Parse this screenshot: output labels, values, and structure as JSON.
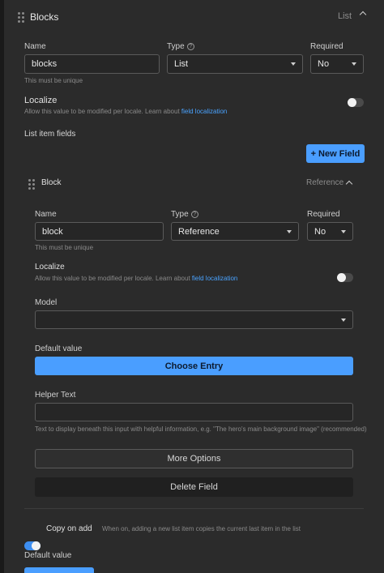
{
  "field": {
    "title": "Blocks",
    "type_badge": "List",
    "name_label": "Name",
    "name_value": "blocks",
    "name_hint": "This must be unique",
    "type_label": "Type",
    "type_value": "List",
    "required_label": "Required",
    "required_value": "No",
    "localize_label": "Localize",
    "localize_hint": "Allow this value to be modified per locale. Learn about",
    "localize_link": "field localization",
    "list_item_fields_label": "List item fields",
    "new_field_button": "+ New Field",
    "copy_on_add_label": "Copy on add",
    "copy_on_add_hint": "When on, adding a new list item copies the current last item in the list",
    "default_value_label": "Default value"
  },
  "sub_field": {
    "title": "Block",
    "type_badge": "Reference",
    "name_label": "Name",
    "name_value": "block",
    "name_hint": "This must be unique",
    "type_label": "Type",
    "type_value": "Reference",
    "required_label": "Required",
    "required_value": "No",
    "localize_label": "Localize",
    "localize_hint": "Allow this value to be modified per locale. Learn about",
    "localize_link": "field localization",
    "model_label": "Model",
    "model_value": "",
    "default_value_label": "Default value",
    "choose_entry_button": "Choose Entry",
    "helper_text_label": "Helper Text",
    "helper_text_value": "",
    "helper_text_hint": "Text to display beneath this input with helpful information, e.g. \"The hero's main background image\" (recommended)",
    "more_options_button": "More Options",
    "delete_field_button": "Delete Field"
  },
  "colors": {
    "accent": "#4a9eff",
    "background": "#2b2b2b",
    "link": "#4aa3ff"
  }
}
